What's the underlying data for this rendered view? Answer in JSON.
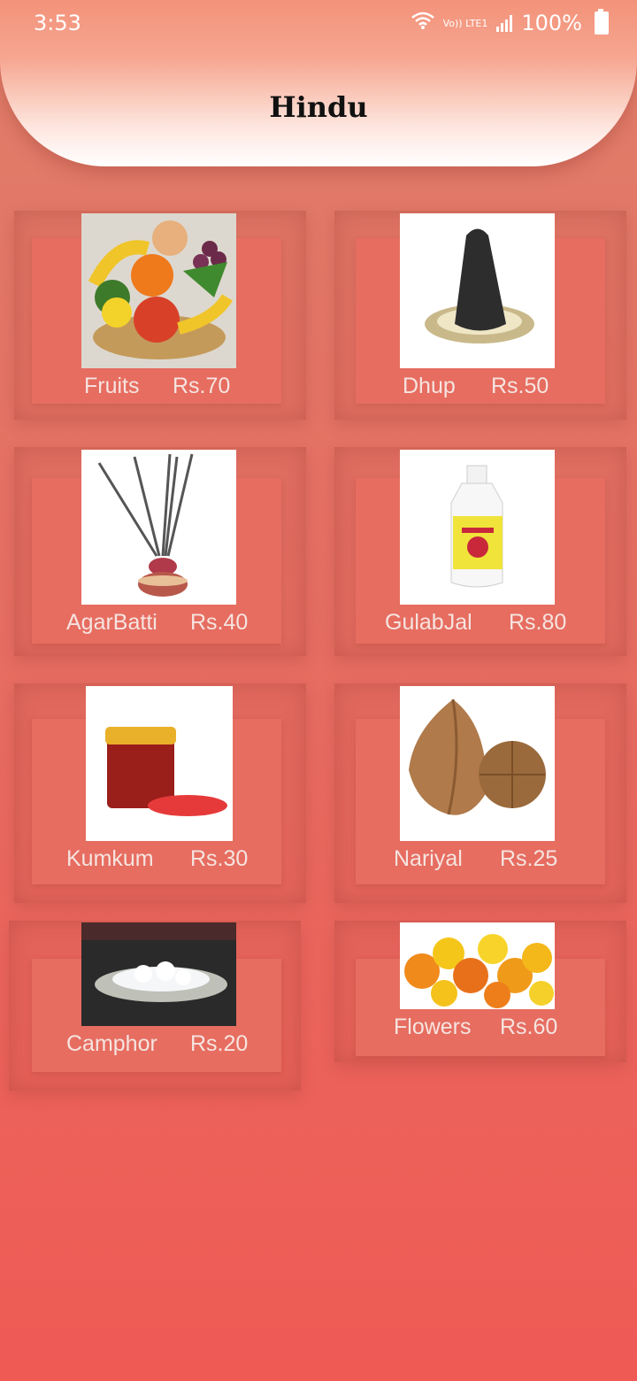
{
  "status": {
    "time": "3:53",
    "battery": "100%",
    "volte": "Vo)) LTE1"
  },
  "header": {
    "title": "Hindu"
  },
  "items": [
    {
      "name": "Fruits",
      "price": "Rs.70",
      "icon": "fruit-basket-image"
    },
    {
      "name": "Dhup",
      "price": "Rs.50",
      "icon": "dhup-cone-image"
    },
    {
      "name": "AgarBatti",
      "price": "Rs.40",
      "icon": "incense-sticks-image"
    },
    {
      "name": "GulabJal",
      "price": "Rs.80",
      "icon": "rose-water-bottle-image"
    },
    {
      "name": "Kumkum",
      "price": "Rs.30",
      "icon": "kumkum-jar-image"
    },
    {
      "name": "Nariyal",
      "price": "Rs.25",
      "icon": "coconut-image"
    },
    {
      "name": "Camphor",
      "price": "Rs.20",
      "icon": "camphor-plate-image"
    },
    {
      "name": "Flowers",
      "price": "Rs.60",
      "icon": "marigold-flowers-image"
    }
  ],
  "colors": {
    "accent": "#e66d60",
    "label": "#f6e4e0"
  }
}
